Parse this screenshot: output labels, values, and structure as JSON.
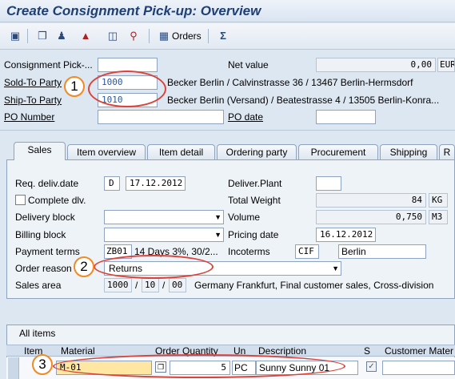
{
  "title": "Create Consignment Pick-up: Overview",
  "toolbar": {
    "icons": [
      "display-document-icon",
      "copy-icon",
      "header-person-icon",
      "home-icon",
      "flow-icon",
      "search-icon",
      "grid-icon",
      "sigma-icon"
    ],
    "orders_label": "Orders"
  },
  "header": {
    "consignment_label": "Consignment Pick-...",
    "consignment_value": "",
    "net_value_label": "Net value",
    "net_value": "0,00",
    "currency": "EUR",
    "sold_to_label": "Sold-To Party",
    "sold_to_value": "1000",
    "sold_to_desc": "Becker Berlin / Calvinstrasse 36 / 13467 Berlin-Hermsdorf",
    "ship_to_label": "Ship-To Party",
    "ship_to_value": "1010",
    "ship_to_desc": "Becker Berlin (Versand) / Beatestrasse 4 / 13505 Berlin-Konra...",
    "po_number_label": "PO Number",
    "po_number_value": "",
    "po_date_label": "PO date",
    "po_date_value": ""
  },
  "tabs": [
    "Sales",
    "Item overview",
    "Item detail",
    "Ordering party",
    "Procurement",
    "Shipping",
    "R"
  ],
  "sales": {
    "req_deliv_label": "Req. deliv.date",
    "req_deliv_type": "D",
    "req_deliv_date": "17.12.2012",
    "deliver_plant_label": "Deliver.Plant",
    "deliver_plant_value": "",
    "complete_dlv_label": "Complete dlv.",
    "total_weight_label": "Total Weight",
    "total_weight_value": "84",
    "total_weight_unit": "KG",
    "delivery_block_label": "Delivery block",
    "delivery_block_value": "",
    "volume_label": "Volume",
    "volume_value": "0,750",
    "volume_unit": "M3",
    "billing_block_label": "Billing block",
    "billing_block_value": "",
    "pricing_date_label": "Pricing date",
    "pricing_date_value": "16.12.2012",
    "payment_terms_label": "Payment terms",
    "payment_terms_code": "ZB01",
    "payment_terms_desc": "14 Days 3%, 30/2...",
    "incoterms_label": "Incoterms",
    "incoterms_code": "CIF",
    "incoterms_place": "Berlin",
    "order_reason_label": "Order reason",
    "order_reason_value": "Returns",
    "sales_area_label": "Sales area",
    "sales_area_org": "1000",
    "sales_area_channel": "10",
    "sales_area_division": "00",
    "sales_area_desc": "Germany Frankfurt, Final customer sales, Cross-division"
  },
  "items": {
    "section_label": "All items",
    "columns": [
      "Item",
      "Material",
      "Order Quantity",
      "Un",
      "Description",
      "S",
      "Customer Mater"
    ],
    "row": {
      "item": "",
      "material": "M-01",
      "quantity": "5",
      "unit": "PC",
      "description": "Sunny Sunny 01",
      "status_checked": true
    }
  },
  "callouts": [
    "1",
    "2",
    "3"
  ],
  "colors": {
    "callout_outline": "#d9433a",
    "badge_border": "#f08a24",
    "title": "#1f3f75"
  }
}
